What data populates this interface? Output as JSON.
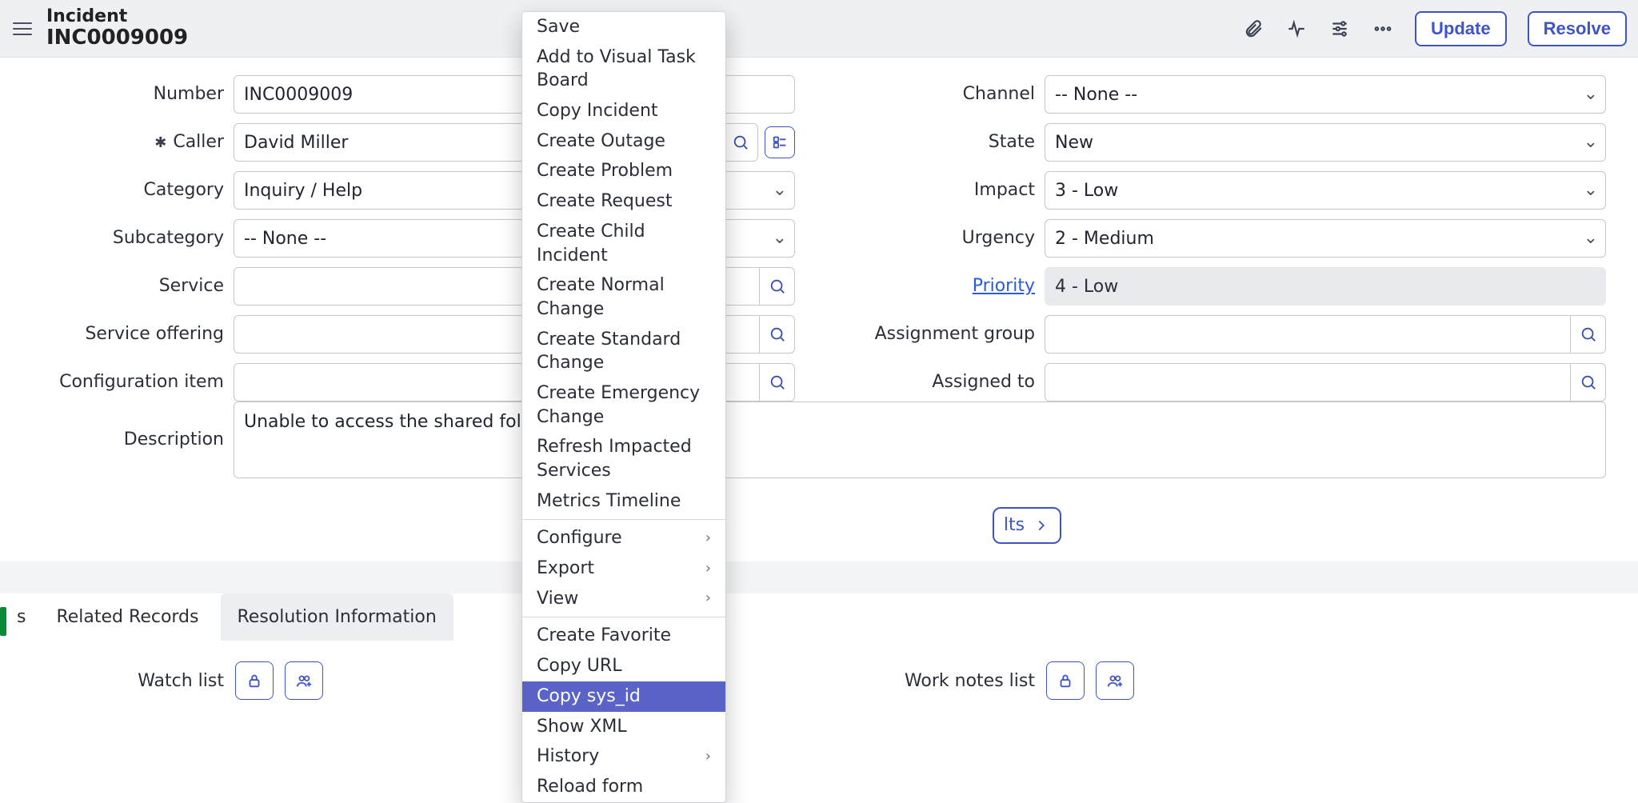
{
  "header": {
    "title": "Incident",
    "record_number": "INC0009009",
    "buttons": {
      "update": "Update",
      "resolve": "Resolve"
    }
  },
  "left_fields": {
    "number_label": "Number",
    "number_value": "INC0009009",
    "caller_label": "Caller",
    "caller_value": "David Miller",
    "category_label": "Category",
    "category_value": "Inquiry / Help",
    "subcategory_label": "Subcategory",
    "subcategory_value": "-- None --",
    "service_label": "Service",
    "service_value": "",
    "service_offering_label": "Service offering",
    "service_offering_value": "",
    "ci_label": "Configuration item",
    "ci_value": "",
    "description_label": "Description",
    "description_value": "Unable to access the shared folder. Please provide"
  },
  "right_fields": {
    "channel_label": "Channel",
    "channel_value": "-- None --",
    "state_label": "State",
    "state_value": "New",
    "impact_label": "Impact",
    "impact_value": "3 - Low",
    "urgency_label": "Urgency",
    "urgency_value": "2 - Medium",
    "priority_label": "Priority",
    "priority_value": "4 - Low",
    "assignment_group_label": "Assignment group",
    "assignment_group_value": "",
    "assigned_to_label": "Assigned to",
    "assigned_to_value": ""
  },
  "pill": {
    "label_suffix": "lts"
  },
  "tabs": {
    "stub": "s",
    "related_records": "Related Records",
    "resolution_info": "Resolution Information"
  },
  "lists": {
    "watch_list_label": "Watch list",
    "work_notes_list_label": "Work notes list"
  },
  "context_menu": {
    "save": "Save",
    "add_vtb": "Add to Visual Task Board",
    "copy_incident": "Copy Incident",
    "create_outage": "Create Outage",
    "create_problem": "Create Problem",
    "create_request": "Create Request",
    "create_child_incident": "Create Child Incident",
    "create_normal_change": "Create Normal Change",
    "create_standard_change": "Create Standard Change",
    "create_emergency_change": "Create Emergency Change",
    "refresh_impacted": "Refresh Impacted Services",
    "metrics_timeline": "Metrics Timeline",
    "configure": "Configure",
    "export": "Export",
    "view": "View",
    "create_favorite": "Create Favorite",
    "copy_url": "Copy URL",
    "copy_sys_id": "Copy sys_id",
    "show_xml": "Show XML",
    "history": "History",
    "reload_form": "Reload form"
  }
}
